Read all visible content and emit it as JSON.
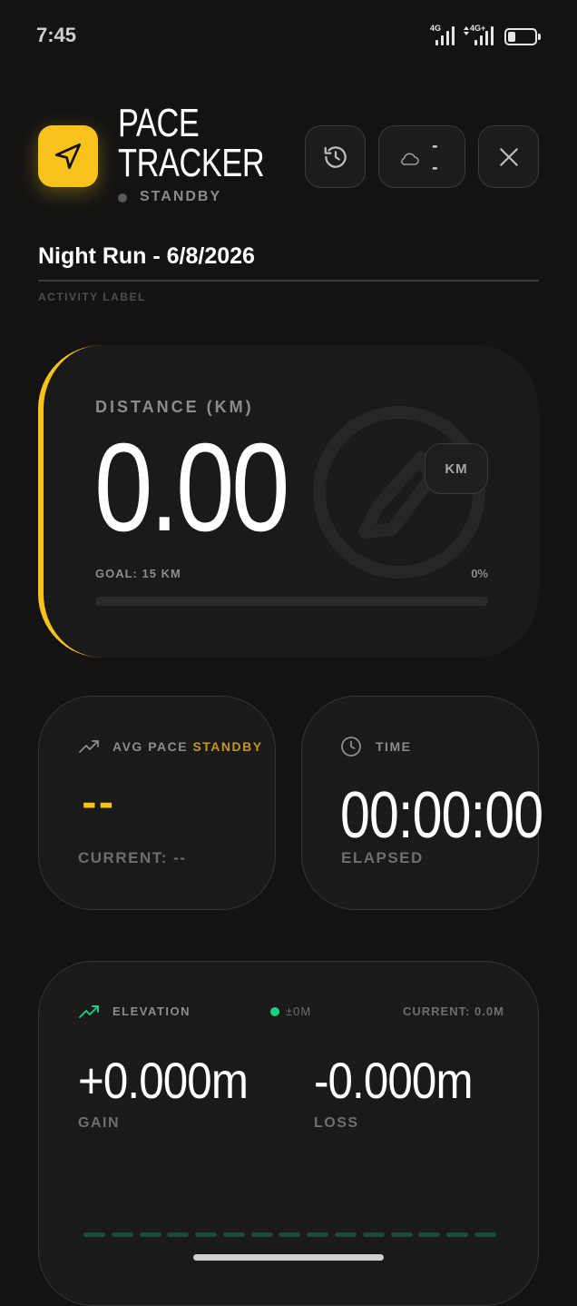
{
  "status_bar": {
    "time": "7:45",
    "signal_1_label": "4G",
    "signal_2_label": "4G+",
    "battery_level": 0.3
  },
  "header": {
    "app_title_line1": "PACE",
    "app_title_line2": "TRACKER",
    "status": "STANDBY",
    "weather_line1": "-",
    "weather_line2": "-",
    "icons": [
      "navigation-arrow-icon",
      "history-icon",
      "cloud-icon",
      "close-icon"
    ]
  },
  "activity": {
    "name": "Night Run - 6/8/2026",
    "caption": "ACTIVITY LABEL"
  },
  "distance": {
    "label": "DISTANCE (KM)",
    "value": "0.00",
    "unit": "KM",
    "goal": "GOAL: 15 KM",
    "percent_text": "0%",
    "progress": 0
  },
  "pace": {
    "label": "AVG PACE",
    "status": "STANDBY",
    "value": "--",
    "current": "CURRENT: --"
  },
  "time": {
    "label": "TIME",
    "value": "00:00:00",
    "sub": "ELAPSED"
  },
  "elevation": {
    "label": "ELEVATION",
    "delta": "±0M",
    "current": "CURRENT: 0.0M",
    "gain_value": "+0.000m",
    "gain_label": "GAIN",
    "loss_value": "-0.000m",
    "loss_label": "LOSS",
    "accent_color": "#19d18a"
  },
  "colors": {
    "accent": "#f7c21a",
    "background": "#131313",
    "card": "#1a1a1a"
  }
}
